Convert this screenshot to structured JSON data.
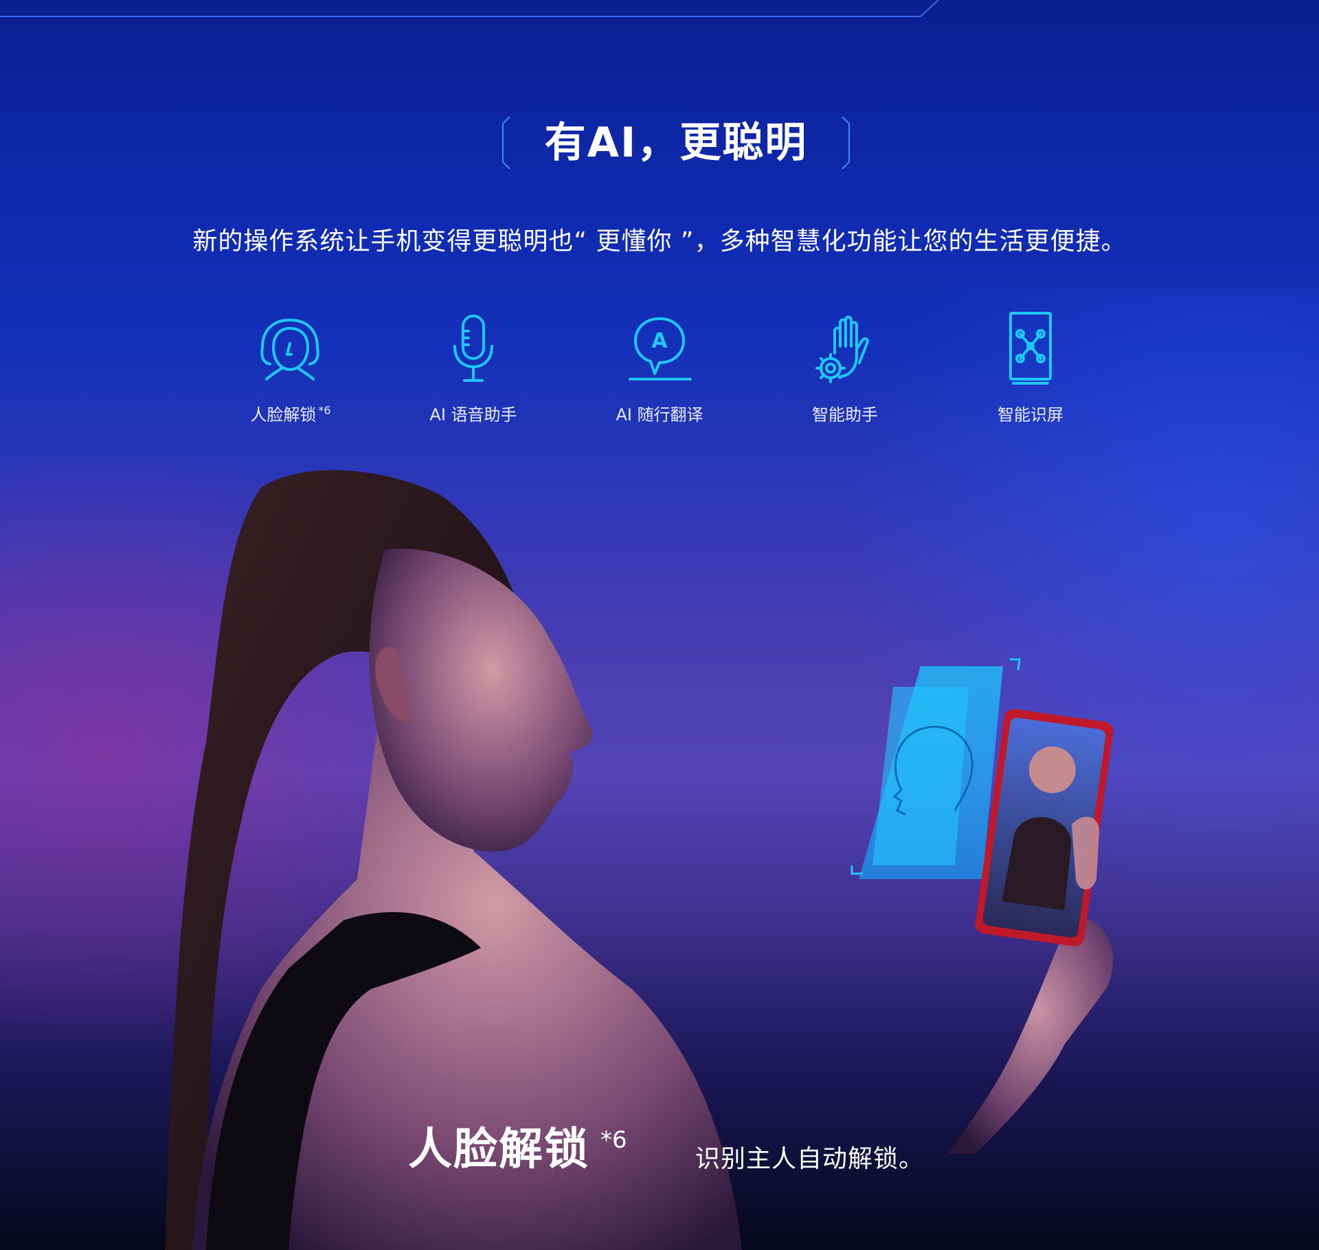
{
  "header": {
    "title": "有AI，更聪明",
    "subtitle": "新的操作系统让手机变得更聪明也“ 更懂你 ”，多种智慧化功能让您的生活更便捷。"
  },
  "features": [
    {
      "label": "人脸解锁",
      "sup": "*6",
      "icon": "face-icon"
    },
    {
      "label": "AI 语音助手",
      "icon": "microphone-icon"
    },
    {
      "label": "AI 随行翻译",
      "icon": "translate-icon"
    },
    {
      "label": "智能助手",
      "icon": "hand-gear-icon"
    },
    {
      "label": "智能识屏",
      "icon": "screen-recognition-icon"
    }
  ],
  "bottom": {
    "title": "人脸解锁",
    "sup": "*6",
    "desc": "识别主人自动解锁。"
  },
  "colors": {
    "icon_stroke": "#1ec8ff",
    "accent_cyan": "#19c6ff"
  }
}
